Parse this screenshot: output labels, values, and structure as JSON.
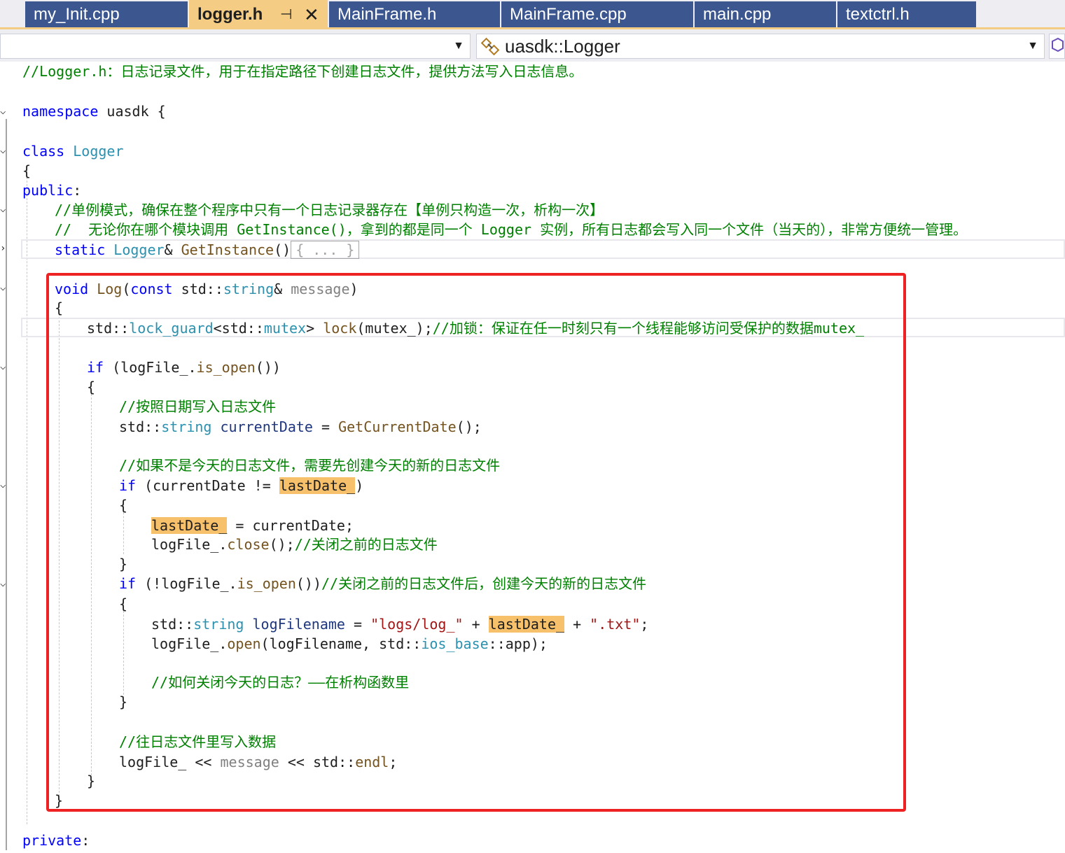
{
  "tabs": [
    {
      "label": "my_Init.cpp",
      "active": false
    },
    {
      "label": "logger.h",
      "active": true,
      "pin": "⊣",
      "close": "✕"
    },
    {
      "label": "MainFrame.h",
      "active": false
    },
    {
      "label": "MainFrame.cpp",
      "active": false
    },
    {
      "label": "main.cpp",
      "active": false
    },
    {
      "label": "textctrl.h",
      "active": false
    }
  ],
  "navbar": {
    "scope_value": "",
    "member_value": "uasdk::Logger",
    "member_icon": "class-icon",
    "dropdown_glyph": "▼"
  },
  "colors": {
    "keyword": "#0000ff",
    "type": "#2b91af",
    "comment": "#008000",
    "function": "#74531f",
    "parameter": "#808080",
    "string": "#a31515",
    "highlight": "#f7c16b",
    "annotation_box": "#ee2222",
    "active_tab": "#f5cc84",
    "inactive_tab": "#3c5790"
  },
  "code": {
    "l1": {
      "c": "//Logger.h：日志记录文件，用于在指定路径下创建日志文件，提供方法写入日志信息。"
    },
    "l2": {
      "k": "namespace",
      "t": " uasdk {"
    },
    "l3": {
      "k": "class",
      "t": "Logger"
    },
    "l4": {
      "t": "{"
    },
    "l5": {
      "k": "public",
      "t": ":"
    },
    "l6": {
      "c": "//单例模式，确保在整个程序中只有一个日志记录器存在【单例只构造一次，析构一次】"
    },
    "l7": {
      "c": "//  无论你在哪个模块调用 GetInstance()，拿到的都是同一个 Logger 实例，所有日志都会写入同一个文件（当天的），非常方便统一管理。"
    },
    "l8": {
      "k": "static",
      "t": "Logger",
      "op": "&",
      "f": "GetInstance",
      "p": "()",
      "box": "{ ... }"
    },
    "l9": {
      "k": "void",
      "f": "Log",
      "a": "(",
      "k2": "const",
      "t1": "std::",
      "t2": "string",
      "op": "&",
      "pm": "message",
      "b": ")"
    },
    "l10": {
      "t": "{"
    },
    "l11": {
      "a": "std::",
      "t": "lock_guard",
      "b": "<std::",
      "t2": "mutex",
      "d": "> ",
      "f": "lock",
      "e": "(mutex_);",
      "c": "//加锁：保证在任一时刻只有一个线程能够访问受保护的数据mutex_"
    },
    "l12": {
      "k": "if",
      "a": " (logFile_.",
      "f": "is_open",
      "b": "())"
    },
    "l13": {
      "t": "{"
    },
    "l14": {
      "c": "//按照日期写入日志文件"
    },
    "l15": {
      "a": "std::",
      "t": "string",
      "v": " currentDate",
      "b": " = ",
      "f": "GetCurrentDate",
      "e": "();"
    },
    "l16": {
      "c": "//如果不是今天的日志文件，需要先创建今天的新的日志文件"
    },
    "l17": {
      "k": "if",
      "a": " (currentDate ",
      "op": "!=",
      "sp": " ",
      "h": "lastDate_",
      "b": ")"
    },
    "l18": {
      "t": "{"
    },
    "l19": {
      "h": "lastDate_",
      "op": " = ",
      "a": "currentDate;"
    },
    "l20": {
      "a": "logFile_.",
      "f": "close",
      "b": "();",
      "c": "//关闭之前的日志文件"
    },
    "l21": {
      "t": "}"
    },
    "l22": {
      "k": "if",
      "a": " (!logFile_.",
      "f": "is_open",
      "b": "())",
      "c": "//关闭之前的日志文件后，创建今天的新的日志文件"
    },
    "l23": {
      "t": "{"
    },
    "l24": {
      "a": "std::",
      "t": "string",
      "v": " logFilename",
      "b": " = ",
      "s1": "\"logs/log_\"",
      "op1": " + ",
      "h": "lastDate_",
      "op2": " + ",
      "s2": "\".txt\"",
      "e": ";"
    },
    "l25": {
      "a": "logFile_.",
      "f": "open",
      "b": "(logFilename, std::",
      "t": "ios_base",
      "e": "::app);"
    },
    "l26": {
      "c": "//如何关闭今天的日志？——在析构函数里"
    },
    "l27": {
      "t": "}"
    },
    "l28": {
      "c": "//往日志文件里写入数据"
    },
    "l29": {
      "a": "logFile_ ",
      "op1": "<<",
      "pm": " message ",
      "op2": "<<",
      "b": " std::",
      "f": "endl",
      "e": ";"
    },
    "l30": {
      "t": "}"
    },
    "l31": {
      "t": "}"
    },
    "l32": {
      "k": "private",
      "t": ":"
    }
  }
}
